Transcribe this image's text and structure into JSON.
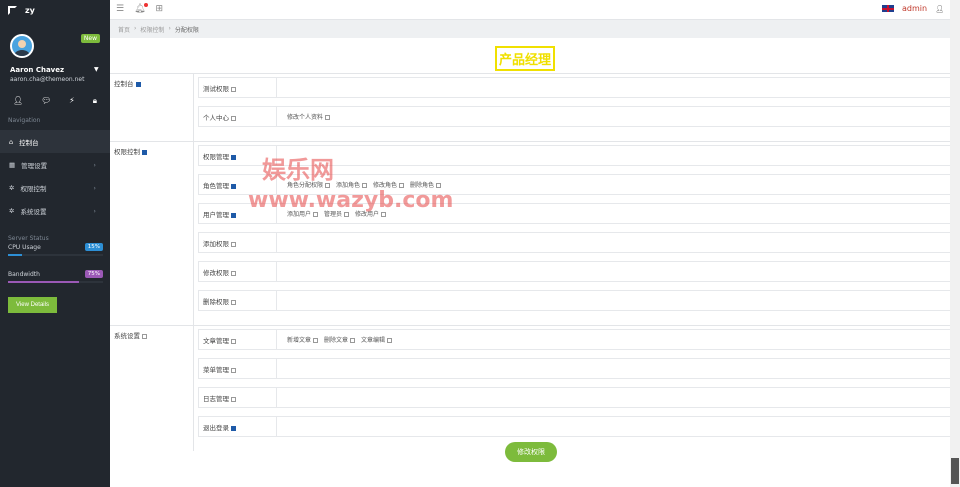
{
  "brand": {
    "name": "zy"
  },
  "profile": {
    "badge": "New",
    "name": "Aaron Chavez",
    "email": "aaron.cha@themeon.net"
  },
  "sidebar": {
    "nav_title": "Navigation",
    "items": [
      {
        "label": "控制台",
        "icon": "home-icon"
      },
      {
        "label": "管理设置",
        "icon": "list-icon"
      },
      {
        "label": "权限控制",
        "icon": "gear-icon"
      },
      {
        "label": "系统设置",
        "icon": "gear-icon"
      }
    ],
    "server_status": "Server Status",
    "cpu_label": "CPU Usage",
    "cpu_value": "15%",
    "cpu_percent": 15,
    "bw_label": "Bandwidth",
    "bw_value": "75%",
    "bw_percent": 75,
    "view_details": "View Details"
  },
  "topbar": {
    "user": "admin"
  },
  "breadcrumb": {
    "home": "首页",
    "mid": "权限控制",
    "current": "分配权限"
  },
  "role_title": "产品经理",
  "sections": [
    {
      "label": "控制台",
      "checked": true,
      "lines": [
        {
          "label": "测试权限",
          "checked": false,
          "perms": []
        },
        {
          "label": "个人中心",
          "checked": false,
          "perms": [
            {
              "label": "修改个人资料",
              "checked": false
            }
          ]
        }
      ]
    },
    {
      "label": "权限控制",
      "checked": true,
      "lines": [
        {
          "label": "权限管理",
          "checked": true,
          "perms": []
        },
        {
          "label": "角色管理",
          "checked": true,
          "perms": [
            {
              "label": "角色分配权限",
              "checked": false
            },
            {
              "label": "添加角色",
              "checked": false
            },
            {
              "label": "修改角色",
              "checked": false
            },
            {
              "label": "删除角色",
              "checked": false
            }
          ]
        },
        {
          "label": "用户管理",
          "checked": true,
          "perms": [
            {
              "label": "添加用户",
              "checked": false
            },
            {
              "label": "管理员",
              "checked": false
            },
            {
              "label": "修改用户",
              "checked": false
            }
          ]
        },
        {
          "label": "添加权限",
          "checked": false,
          "perms": []
        },
        {
          "label": "修改权限",
          "checked": false,
          "perms": []
        },
        {
          "label": "删除权限",
          "checked": false,
          "perms": []
        }
      ]
    },
    {
      "label": "系统设置",
      "checked": false,
      "lines": [
        {
          "label": "文章管理",
          "checked": false,
          "perms": [
            {
              "label": "新增文章",
              "checked": false
            },
            {
              "label": "删除文章",
              "checked": false
            },
            {
              "label": "文章编辑",
              "checked": false
            }
          ]
        },
        {
          "label": "菜单管理",
          "checked": false,
          "perms": []
        },
        {
          "label": "日志管理",
          "checked": false,
          "perms": []
        },
        {
          "label": "退出登录",
          "checked": true,
          "perms": []
        }
      ]
    }
  ],
  "submit_label": "修改权限",
  "watermark": {
    "line1": "娱乐网",
    "line2": "www.wazyb.com"
  }
}
